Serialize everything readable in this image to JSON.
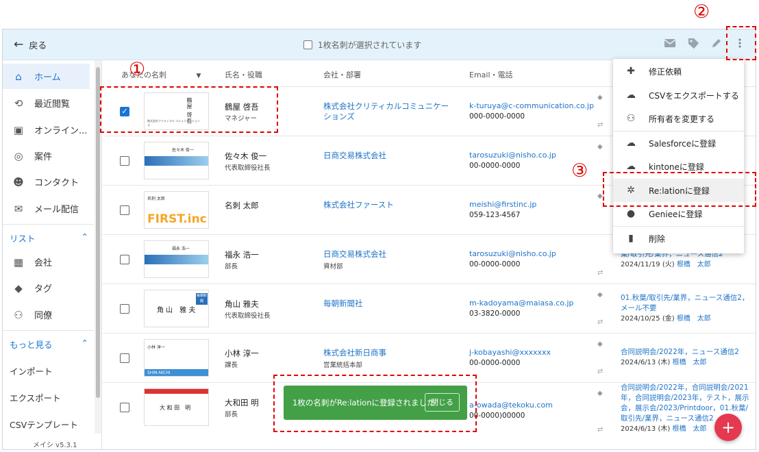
{
  "topbar": {
    "back_label": "戻る",
    "selection_text": "1枚名刺が選択されています",
    "icons": [
      "mail-icon",
      "tag-icon",
      "edit-icon",
      "more-vert-icon"
    ]
  },
  "sidebar": {
    "items": [
      {
        "label": "ホーム",
        "icon": "home-icon",
        "active": true
      },
      {
        "label": "最近閲覧",
        "icon": "history-icon"
      },
      {
        "label": "オンライン...",
        "icon": "id-card-icon"
      },
      {
        "label": "案件",
        "icon": "target-icon"
      },
      {
        "label": "コンタクト",
        "icon": "contact-icon"
      },
      {
        "label": "メール配信",
        "icon": "mail-icon"
      }
    ],
    "list_section": "リスト",
    "list_items": [
      {
        "label": "会社",
        "icon": "building-icon"
      },
      {
        "label": "タグ",
        "icon": "tag-icon"
      },
      {
        "label": "同僚",
        "icon": "people-icon"
      }
    ],
    "more_section": "もっと見る",
    "more_items": [
      "インポート",
      "エクスポート",
      "CSVテンプレート"
    ],
    "version": "メイシ v5.3.1"
  },
  "table": {
    "headers": {
      "card": "あなたの名刺",
      "name": "氏名・役職",
      "company": "会社・部署",
      "email": "Email・電話"
    },
    "rows": [
      {
        "checked": true,
        "name": "鶴屋 啓吾",
        "title": "マネジャー",
        "company": "株式会社クリティカルコミュニケーションズ",
        "dept": "",
        "email": "k-turuya@c-communication.co.jp",
        "phone": "000-0000-0000",
        "tags": "",
        "date": "",
        "owner": ""
      },
      {
        "checked": false,
        "name": "佐々木 俊一",
        "title": "代表取締役社長",
        "company": "日商交易株式会社",
        "dept": "",
        "email": "tarosuzuki@nisho.co.jp",
        "phone": "00-0000-0000",
        "tags": "",
        "date": "",
        "owner": ""
      },
      {
        "checked": false,
        "name": "名刺 太郎",
        "title": "",
        "company": "株式会社ファースト",
        "dept": "",
        "email": "meishi@firstinc.jp",
        "phone": "059-123-4567",
        "tags": "",
        "date": "",
        "owner": ""
      },
      {
        "checked": false,
        "name": "福永 浩一",
        "title": "部長",
        "company": "日商交易株式会社",
        "dept": "資材部",
        "email": "tarosuzuki@nisho.co.jp",
        "phone": "00-0000-0000",
        "tags": "テスト，A，B，展示会/2023，01.秋葉/取引先/業界，ニュース通信2",
        "date": "2024/11/19 (火)",
        "owner": "根橋　太郎"
      },
      {
        "checked": false,
        "name": "角山 雅夫",
        "title": "代表取締役社長",
        "company": "毎朝新聞社",
        "dept": "",
        "email": "m-kadoyama@maiasa.co.jp",
        "phone": "03-3820-0000",
        "tags": "01.秋葉/取引先/業界，ニュース通信2，メール不要",
        "date": "2024/10/25 (金)",
        "owner": "根橋　太郎"
      },
      {
        "checked": false,
        "name": "小林 淳一",
        "title": "課長",
        "company": "株式会社新日商事",
        "dept": "営業統括本部",
        "email": "j-kobayashi@xxxxxxx",
        "phone": "00-0000-0000",
        "tags": "合同説明会/2022年，ニュース通信2",
        "date": "2024/6/13 (木)",
        "owner": "根橋　太郎"
      },
      {
        "checked": false,
        "name": "大和田 明",
        "title": "部長",
        "company": "",
        "dept": "",
        "email": "a-owada@tekoku.com",
        "phone": "00-0000)00000",
        "tags": "合同説明会/2022年，合同説明会/2021年，合同説明会/2023年，テスト，展示会，展示会/2023/Printdoor，01.秋葉/取引先/業界，ニュース通信2",
        "date": "2024/6/13 (木)",
        "owner": "根橋　太郎"
      }
    ]
  },
  "cards": {
    "row0": {
      "kanji": "鶴屋 啓吾",
      "line": "株式会社クリティカル コミュニケーションズ"
    },
    "row1": {
      "head": "佐々木 俊一"
    },
    "row2": {
      "head": "名刺 太郎",
      "logo": "FIRST.inc"
    },
    "row3": {
      "head": "福永 浩一"
    },
    "row4": {
      "head": "角 山　雅 夫",
      "badge": "毎朝新聞"
    },
    "row5": {
      "head": "小林 淳一",
      "footer": "SHIN-NICHI"
    },
    "row6": {
      "head": "大 和 田　明"
    }
  },
  "menu": {
    "items": [
      {
        "label": "修正依頼",
        "icon": "puzzle-icon"
      },
      {
        "label": "CSVをエクスポートする",
        "icon": "cloud-download-icon"
      },
      {
        "label": "所有者を変更する",
        "icon": "owner-change-icon"
      },
      {
        "label": "Salesforceに登録",
        "icon": "salesforce-icon"
      },
      {
        "label": "kintoneに登録",
        "icon": "kintone-icon"
      },
      {
        "label": "Re:lationに登録",
        "icon": "relation-icon",
        "highlighted": true
      },
      {
        "label": "Genieeに登録",
        "icon": "geniee-icon"
      },
      {
        "label": "削除",
        "icon": "trash-icon"
      }
    ]
  },
  "snackbar": {
    "message": "1枚の名刺がRe:lationに登録されました",
    "close_label": "閉じる"
  },
  "fab": {
    "label": "+"
  },
  "annotations": {
    "one": "①",
    "two": "②",
    "three": "③"
  },
  "colors": {
    "accent": "#1976d2",
    "link": "#1e73c8",
    "success": "#43a047",
    "fab": "#e53950",
    "annotation": "#e00000",
    "topbar": "#e3f2fb"
  }
}
